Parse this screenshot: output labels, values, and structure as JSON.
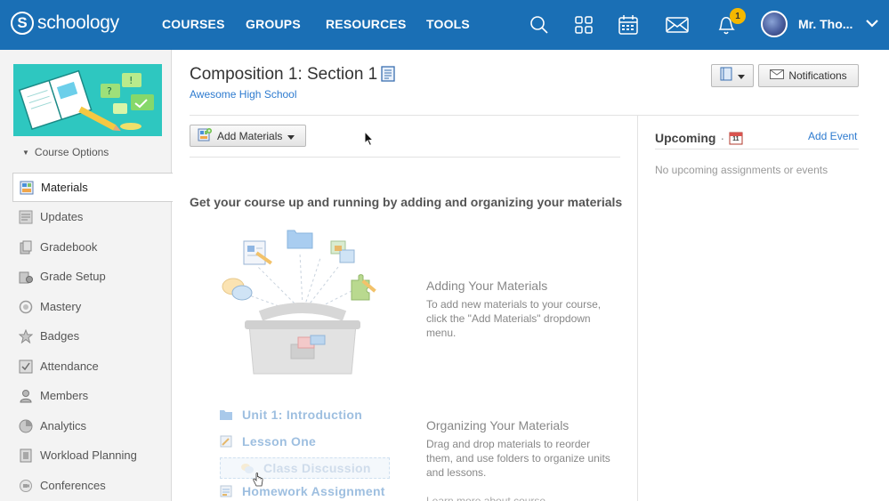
{
  "brand": {
    "name": "schoology",
    "mark": "S"
  },
  "nav": [
    {
      "label": "COURSES"
    },
    {
      "label": "GROUPS"
    },
    {
      "label": "RESOURCES"
    },
    {
      "label": "TOOLS"
    }
  ],
  "header": {
    "notification_count": "1",
    "user_name": "Mr. Tho..."
  },
  "sidebar": {
    "course_options": "Course Options",
    "items": [
      {
        "label": "Materials",
        "icon": "materials-icon",
        "active": true
      },
      {
        "label": "Updates",
        "icon": "updates-icon"
      },
      {
        "label": "Gradebook",
        "icon": "gradebook-icon"
      },
      {
        "label": "Grade Setup",
        "icon": "grade-setup-icon"
      },
      {
        "label": "Mastery",
        "icon": "mastery-icon"
      },
      {
        "label": "Badges",
        "icon": "badges-icon"
      },
      {
        "label": "Attendance",
        "icon": "attendance-icon"
      },
      {
        "label": "Members",
        "icon": "members-icon"
      },
      {
        "label": "Analytics",
        "icon": "analytics-icon"
      },
      {
        "label": "Workload Planning",
        "icon": "workload-icon"
      },
      {
        "label": "Conferences",
        "icon": "conferences-icon"
      }
    ]
  },
  "main": {
    "title": "Composition 1: Section 1",
    "school": "Awesome High School",
    "notifications_label": "Notifications",
    "add_materials_label": "Add Materials",
    "empty_heading": "Get your course up and running by adding and organizing your materials",
    "adding": {
      "title": "Adding Your Materials",
      "body": "To add new materials to your course, click the \"Add Materials\" dropdown menu."
    },
    "organizing": {
      "title": "Organizing Your Materials",
      "body": "Drag and drop materials to reorder them, and use folders to organize units and lessons.",
      "learn_more": "Learn more about course"
    },
    "demo_items": [
      {
        "label": "Unit 1: Introduction",
        "icon": "folder-icon"
      },
      {
        "label": "Lesson One",
        "icon": "assignment-icon"
      },
      {
        "label": "Class Discussion",
        "icon": "discussion-icon"
      },
      {
        "label": "Homework Assignment",
        "icon": "homework-icon"
      }
    ]
  },
  "upcoming": {
    "title": "Upcoming",
    "calendar_day": "11",
    "add_event": "Add Event",
    "empty": "No upcoming assignments or events"
  },
  "colors": {
    "topbar": "#1a6fb5",
    "link": "#2e7bcf",
    "badge": "#f5b800",
    "course_image": "#2ec7c0"
  }
}
